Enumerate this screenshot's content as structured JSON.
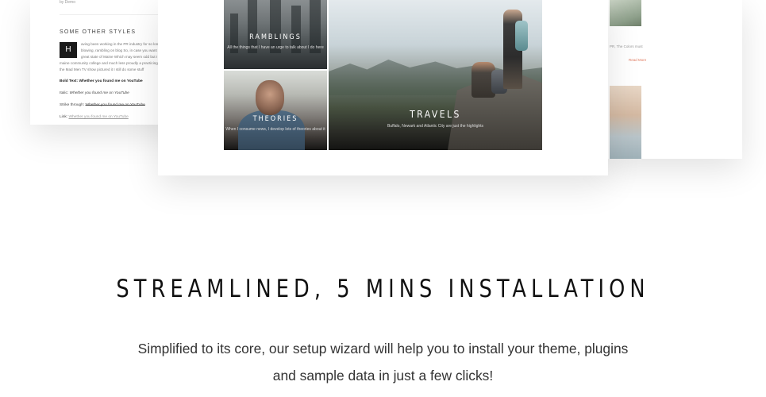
{
  "left_card": {
    "byline": "by Demo",
    "section_heading": "SOME OTHER STYLES",
    "dropcap": "H",
    "paragraph_lines": [
      "aving been working in the PR industry for so long",
      "blowing, rambling on blog So, in case you want to",
      "great state of Maine Which may seem odd but I",
      "maine community college and much less proudly a practicing",
      "the Mad Men TV show pictured it I still do some stuff"
    ],
    "styles": [
      {
        "label": "Bold Text:",
        "value": "Whether you found me on YouTube"
      },
      {
        "label": "Italic:",
        "value": "Whether you found me on YouTube"
      },
      {
        "label": "Strike through:",
        "value": "Whether you found me on YouTube"
      },
      {
        "label": "Link:",
        "value": "Whether you found me on YouTube"
      }
    ]
  },
  "right_card": {
    "caption": "PR, The Colors must",
    "read_more": "Read More"
  },
  "tiles": {
    "ramblings": {
      "title": "RAMBLINGS",
      "subtitle": "All the things that I have an urge to talk about I do here"
    },
    "theories": {
      "title": "THEORIES",
      "subtitle": "When I consume news, I develop lots of theories about it"
    },
    "travels": {
      "title": "TRAVELS",
      "subtitle": "Buffalo, Newark and Atlantic City are just the highlights"
    }
  },
  "headline": "STREAMLINED, 5 MINS INSTALLATION",
  "description": "Simplified to its core, our setup wizard will help you to install your theme, plugins and sample data in just a few clicks!"
}
